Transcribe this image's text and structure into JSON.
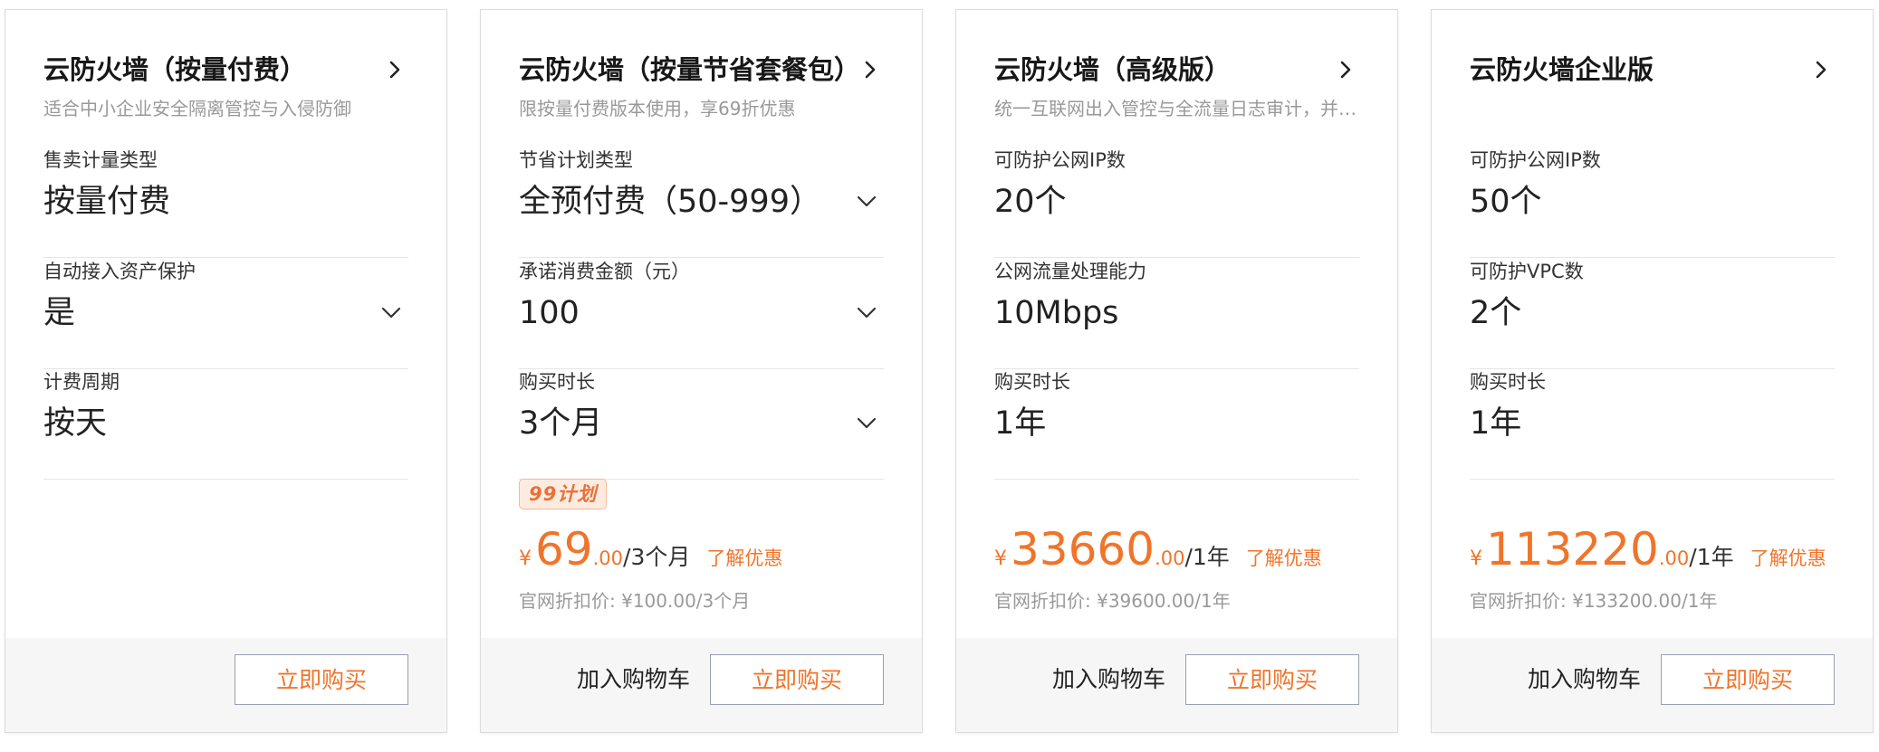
{
  "cards": [
    {
      "title": "云防火墙（按量付费）",
      "subtitle": "适合中小企业安全隔离管控与入侵防御",
      "specs": [
        {
          "label": "售卖计量类型",
          "value": "按量付费",
          "dropdown": false
        },
        {
          "label": "自动接入资产保护",
          "value": "是",
          "dropdown": true
        },
        {
          "label": "计费周期",
          "value": "按天",
          "dropdown": false
        }
      ],
      "buy_label": "立即购买"
    },
    {
      "title": "云防火墙（按量节省套餐包）",
      "subtitle": "限按量付费版本使用，享69折优惠",
      "specs": [
        {
          "label": "节省计划类型",
          "value": "全预付费（50-999）",
          "dropdown": true
        },
        {
          "label": "承诺消费金额（元）",
          "value": "100",
          "dropdown": true
        },
        {
          "label": "购买时长",
          "value": "3个月",
          "dropdown": true
        }
      ],
      "badge": "99计划",
      "price": {
        "currency": "¥",
        "amount": "69",
        "decimal": ".00",
        "unit": "/3个月",
        "promo": "了解优惠",
        "original": "官网折扣价: ¥100.00/3个月"
      },
      "cart_label": "加入购物车",
      "buy_label": "立即购买"
    },
    {
      "title": "云防火墙（高级版）",
      "subtitle": "统一互联网出入管控与全流量日志审计，并支持告警与策略的综合防护",
      "specs": [
        {
          "label": "可防护公网IP数",
          "value": "20个",
          "dropdown": false
        },
        {
          "label": "公网流量处理能力",
          "value": "10Mbps",
          "dropdown": false
        },
        {
          "label": "购买时长",
          "value": "1年",
          "dropdown": false
        }
      ],
      "price": {
        "currency": "¥",
        "amount": "33660",
        "decimal": ".00",
        "unit": "/1年",
        "promo": "了解优惠",
        "original": "官网折扣价: ¥39600.00/1年"
      },
      "cart_label": "加入购物车",
      "buy_label": "立即购买"
    },
    {
      "title": "云防火墙企业版",
      "subtitle": "",
      "specs": [
        {
          "label": "可防护公网IP数",
          "value": "50个",
          "dropdown": false
        },
        {
          "label": "可防护VPC数",
          "value": "2个",
          "dropdown": false
        },
        {
          "label": "购买时长",
          "value": "1年",
          "dropdown": false
        }
      ],
      "price": {
        "currency": "¥",
        "amount": "113220",
        "decimal": ".00",
        "unit": "/1年",
        "promo": "了解优惠",
        "original": "官网折扣价: ¥133200.00/1年"
      },
      "cart_label": "加入购物车",
      "buy_label": "立即购买"
    }
  ],
  "colors": {
    "accent": "#f0742a",
    "muted": "#999999",
    "footer_bg": "#f6f6f6"
  },
  "icons": {
    "title_arrow": "chevron-right-icon",
    "dropdown": "chevron-down-icon"
  }
}
